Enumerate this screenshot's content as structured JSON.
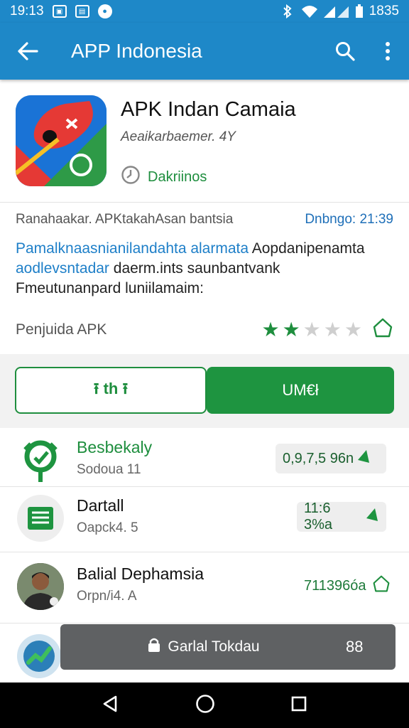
{
  "status_bar": {
    "time": "19:13",
    "right_text": "1835",
    "icons": [
      "photo-icon",
      "image-icon",
      "notification-dot-icon",
      "bluetooth-icon",
      "wifi-icon",
      "signal-icon",
      "battery-icon"
    ]
  },
  "app_bar": {
    "title": "APP Indonesia",
    "icons": [
      "back-arrow-icon",
      "search-icon",
      "overflow-menu-icon"
    ]
  },
  "app": {
    "name": "APK Indan Camaia",
    "developer": "Aeaikarbaemer. 4Y",
    "tag": "Dakriinos"
  },
  "meta": {
    "left": "Ranahaakar. APKtakahAsan bantsia",
    "date": "Dnbngo: 21:39"
  },
  "description": {
    "line1_link": "Pamalknaasnianilandahta alarmata",
    "line1_text": " Aopdanipenamta",
    "line2_link": "aodlevsntadar",
    "line2_text": " daerm.ints saunbantvank",
    "line3": "Fmeutunanpard luniilamaim:"
  },
  "rating": {
    "label": "Penjuida APK",
    "stars_filled": 2,
    "stars_total": 5
  },
  "buttons": {
    "share_label": "⭱ th ⭱",
    "primary_label": "UM€ł"
  },
  "list": [
    {
      "name": "Besbekaly",
      "sub": "Sodoua 11",
      "value": "0,9,7,5 96n"
    },
    {
      "name": "Dartall",
      "sub": "Oapck4. 5",
      "value": "11:6 3%a"
    },
    {
      "name": "Balial Dephamsia",
      "sub": "Orpn/i4. A",
      "value": "711396óa"
    }
  ],
  "snackbar": {
    "message": "Garlal Tokdau",
    "count": "88"
  },
  "colors": {
    "primary": "#1e88c8",
    "accent_green": "#1e9440"
  }
}
